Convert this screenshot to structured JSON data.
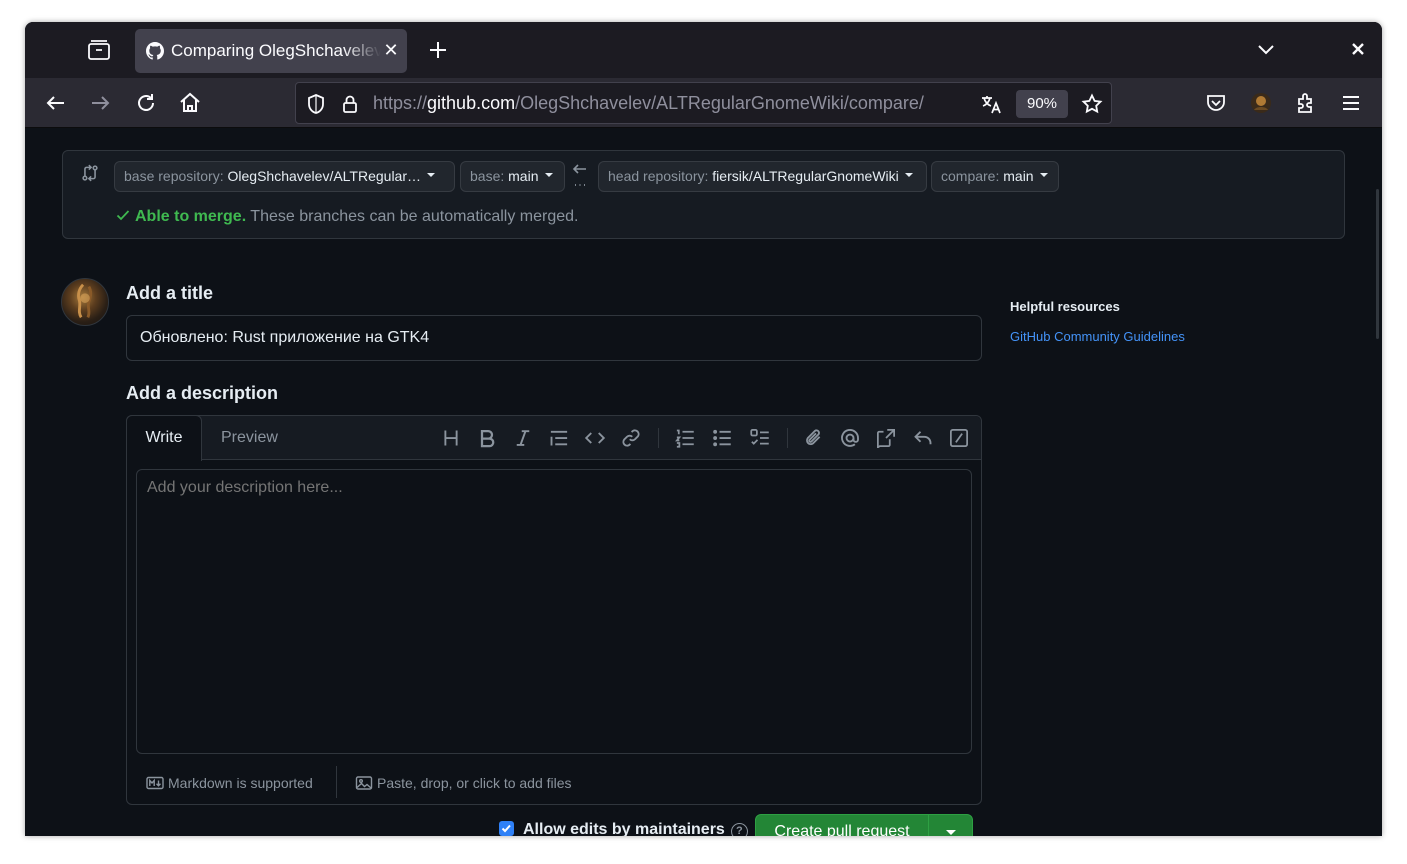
{
  "browser": {
    "tab_title": "Comparing OlegShchavelev",
    "tab_close": "✕",
    "url_scheme": "https://",
    "url_host": "github.com",
    "url_path": "/OlegShchavelev/ALTRegularGnomeWiki/compare/",
    "zoom": "90%",
    "icons": [
      "tab-list-icon",
      "github-favicon",
      "new-tab-icon",
      "tabs-menu-icon",
      "window-close-icon",
      "back-icon",
      "forward-icon",
      "reload-icon",
      "home-icon",
      "shield-icon",
      "lock-icon",
      "translate-icon",
      "bookmark-star-icon",
      "pocket-icon",
      "profile-avatar",
      "extensions-icon",
      "menu-icon"
    ]
  },
  "compare": {
    "base_repo_label": "base repository:",
    "base_repo_value": "OlegShchavelev/ALTRegular…",
    "base_label": "base:",
    "base_value": "main",
    "head_repo_label": "head repository:",
    "head_repo_value": "fiersik/ALTRegularGnomeWiki",
    "compare_label": "compare:",
    "compare_value": "main",
    "merge_ok": "Able to merge.",
    "merge_text": "These branches can be automatically merged."
  },
  "form": {
    "title_heading": "Add a title",
    "title_value": "Обновлено: Rust приложение на GTK4",
    "desc_heading": "Add a description",
    "tab_write": "Write",
    "tab_preview": "Preview",
    "desc_placeholder": "Add your description here...",
    "markdown_note": "Markdown is supported",
    "files_note": "Paste, drop, or click to add files",
    "toolbar_icons": [
      "heading-icon",
      "bold-icon",
      "italic-icon",
      "quote-icon",
      "code-icon",
      "link-icon",
      "ordered-list-icon",
      "unordered-list-icon",
      "task-list-icon",
      "attach-icon",
      "mention-icon",
      "cross-reference-icon",
      "saved-reply-icon",
      "slash-command-icon"
    ],
    "allow_edits": "Allow edits by maintainers",
    "allow_edits_checked": true,
    "help_glyph": "?",
    "create_button": "Create pull request"
  },
  "sidebar": {
    "title": "Helpful resources",
    "link": "GitHub Community Guidelines"
  },
  "colors": {
    "accent_green": "#238636",
    "merge_green": "#3fb950",
    "link_blue": "#4493f8",
    "page_bg": "#0d1117"
  }
}
